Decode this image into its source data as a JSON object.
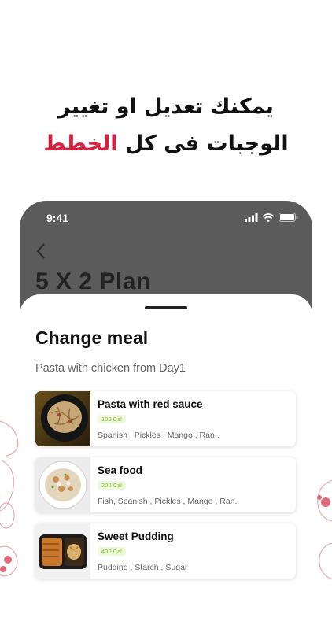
{
  "headline": {
    "line1": "يمكنك تعديل او تغيير",
    "line2_prefix": "الوجبات فى كل ",
    "line2_accent": "الخطط"
  },
  "colors": {
    "accent": "#d3223f",
    "calorie_badge_text": "#7cbf2e"
  },
  "status_bar": {
    "time": "9:41",
    "icons": [
      "signal-icon",
      "wifi-icon",
      "battery-icon"
    ]
  },
  "plan": {
    "back_icon": "chevron-left-icon",
    "title": "5 X 2 Plan"
  },
  "sheet": {
    "title": "Change meal",
    "subtitle": "Pasta with chicken from Day1",
    "meals": [
      {
        "name": "Pasta with red sauce",
        "calories": "100 Cal",
        "ingredients": "Spanish , Pickles  , Mango  , Ran..",
        "image": "pasta-dish"
      },
      {
        "name": "Sea food",
        "calories": "200 Cal",
        "ingredients": "Fish, Spanish , Pickles  , Mango  , Ran..",
        "image": "seafood-dish"
      },
      {
        "name": "Sweet Pudding",
        "calories": "400 Cal",
        "ingredients": "Pudding , Starch , Sugar",
        "image": "pudding-dish"
      }
    ]
  }
}
